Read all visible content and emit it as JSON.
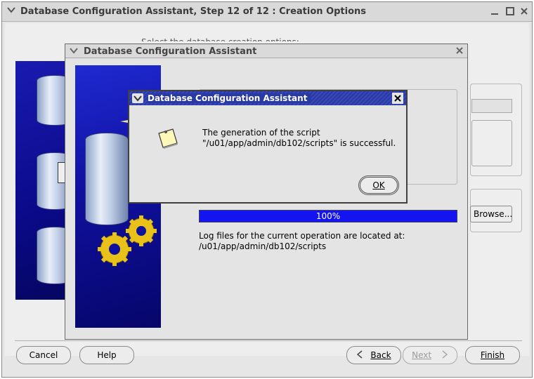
{
  "main_window": {
    "title": "Database Configuration Assistant, Step 12 of 12 : Creation Options",
    "select_prompt": "Select the database creation options:",
    "browse_label": "Browse...",
    "buttons": {
      "cancel": "Cancel",
      "help": "Help",
      "back": "Back",
      "next": "Next",
      "finish": "Finish"
    }
  },
  "progress_dialog": {
    "title": "Database Configuration Assistant",
    "progress_percent": 100,
    "progress_text": "100%",
    "log_line1": "Log files for the current operation are located at:",
    "log_line2": "/u01/app/admin/db102/scripts"
  },
  "message_dialog": {
    "title": "Database Configuration Assistant",
    "message_line1": "The generation of the script",
    "message_line2": "\"/u01/app/admin/db102/scripts\" is successful.",
    "ok_label": "OK"
  },
  "icons": {
    "window_menu": "chevron-down-icon",
    "minimize": "minimize-icon",
    "maximize": "maximize-icon",
    "close": "close-icon",
    "note": "note-icon",
    "back_arrow": "chevron-left-icon",
    "next_arrow": "chevron-right-icon"
  },
  "colors": {
    "progress_fill": "#1414f0",
    "message_titlebar": "#2a3aa4",
    "image_blue": "#1010a0"
  }
}
